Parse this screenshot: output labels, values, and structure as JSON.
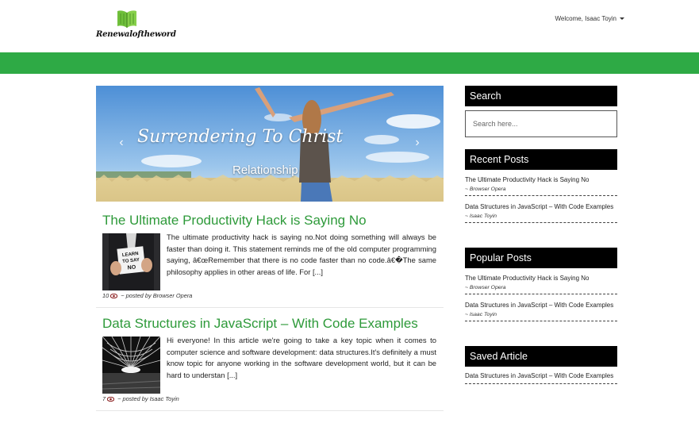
{
  "header": {
    "logo_text": "Renewaloftheword",
    "welcome": "Welcome, Isaac Toyin"
  },
  "colors": {
    "brand_green": "#2eaa45",
    "title_green": "#2e9a3a",
    "sidebar_head": "#000000"
  },
  "carousel": {
    "title": "Surrendering To Christ",
    "caption": "Relationship",
    "prev_icon": "chevron-left-icon",
    "next_icon": "chevron-right-icon"
  },
  "posts": [
    {
      "title": "The Ultimate Productivity Hack is Saying No",
      "excerpt": "The ultimate productivity hack is saying no.Not doing something will always be faster than doing it. This statement reminds me of the old computer programming saying, â€œRemember that there is no code faster than no code.â€�The same philosophy applies in other areas of life. For [...]",
      "views": "10",
      "posted_by": "~ posted by Browser Opera",
      "thumb_text": "LEARN TO SAY NO"
    },
    {
      "title": "Data Structures in JavaScript – With Code Examples",
      "excerpt": "Hi everyone! In this article we're going to take a key topic when it comes to computer science and software development: data structures.It's definitely a must know topic for anyone working in the software development world, but it can be hard to understan [...]",
      "views": "7",
      "posted_by": "~ posted by Isaac Toyin"
    }
  ],
  "sidebar": {
    "search": {
      "heading": "Search",
      "placeholder": "Search here..."
    },
    "recent": {
      "heading": "Recent Posts",
      "items": [
        {
          "title": "The Ultimate Productivity Hack is Saying No",
          "author": "~ Browser Opera"
        },
        {
          "title": "Data Structures in JavaScript – With Code Examples",
          "author": "~ Isaac Toyin"
        }
      ]
    },
    "popular": {
      "heading": "Popular Posts",
      "items": [
        {
          "title": "The Ultimate Productivity Hack is Saying No",
          "author": "~ Browser Opera"
        },
        {
          "title": "Data Structures in JavaScript – With Code Examples",
          "author": "~ Isaac Toyin"
        }
      ]
    },
    "saved": {
      "heading": "Saved Article",
      "items": [
        {
          "title": "Data Structures in JavaScript – With Code Examples"
        }
      ]
    }
  }
}
